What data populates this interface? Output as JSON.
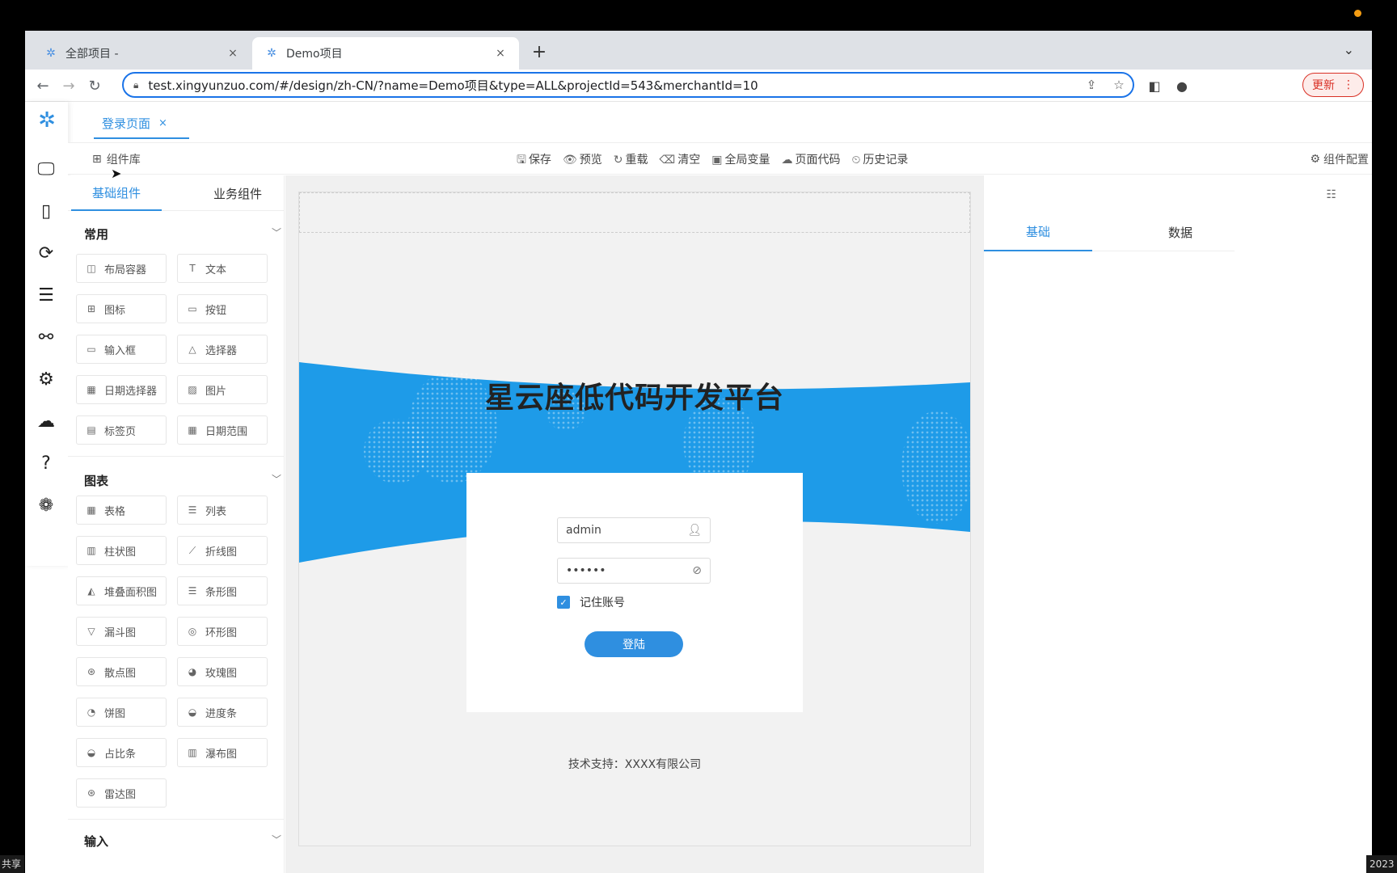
{
  "browser": {
    "tabs": [
      {
        "label": "全部项目 -",
        "close": "×"
      },
      {
        "label": "Demo项目",
        "close": "×"
      }
    ],
    "new_tab": "+",
    "url": "test.xingyunzuo.com/#/design/zh-CN/?name=Demo项目&type=ALL&projectId=543&merchantId=10",
    "update_label": "更新"
  },
  "app": {
    "page_tab": {
      "label": "登录页面",
      "close": "×"
    },
    "toolbar": {
      "library": "组件库",
      "actions": [
        {
          "icon": "save-icon",
          "label": "保存"
        },
        {
          "icon": "eye-icon",
          "label": "预览"
        },
        {
          "icon": "reload-icon",
          "label": "重载"
        },
        {
          "icon": "eraser-icon",
          "label": "清空"
        },
        {
          "icon": "variable-icon",
          "label": "全局变量"
        },
        {
          "icon": "code-icon",
          "label": "页面代码"
        },
        {
          "icon": "history-icon",
          "label": "历史记录"
        }
      ],
      "config": "组件配置"
    },
    "left_panel": {
      "tabs": [
        "基础组件",
        "业务组件"
      ],
      "sections": [
        {
          "title": "常用",
          "items": [
            "布局容器",
            "文本",
            "图标",
            "按钮",
            "输入框",
            "选择器",
            "日期选择器",
            "图片",
            "标签页",
            "日期范围"
          ]
        },
        {
          "title": "图表",
          "items": [
            "表格",
            "列表",
            "柱状图",
            "折线图",
            "堆叠面积图",
            "条形图",
            "漏斗图",
            "环形图",
            "散点图",
            "玫瑰图",
            "饼图",
            "进度条",
            "占比条",
            "瀑布图",
            "雷达图"
          ]
        },
        {
          "title": "输入",
          "items": []
        }
      ]
    },
    "canvas": {
      "banner_title": "星云座低代码开发平台",
      "login": {
        "username": "admin",
        "password": "••••••",
        "remember": "记住账号",
        "button": "登陆"
      },
      "footer": "技术支持：XXXX有限公司"
    },
    "right_panel": {
      "tabs": [
        "基础",
        "数据"
      ]
    }
  },
  "system": {
    "left_corner": "共享",
    "right_corner": "2023"
  },
  "colors": {
    "accent": "#2f8fe0",
    "banner": "#1e9be8"
  }
}
